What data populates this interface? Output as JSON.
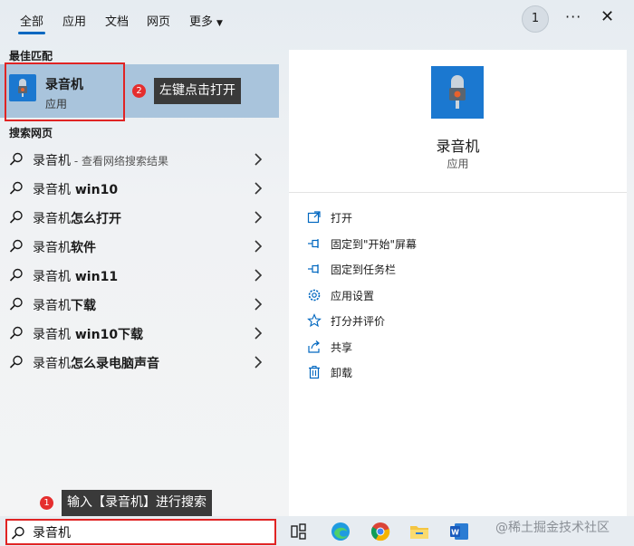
{
  "tabs": {
    "all": "全部",
    "apps": "应用",
    "docs": "文档",
    "web": "网页",
    "more": "更多"
  },
  "header": {
    "count_badge": "1",
    "more_dots": "···",
    "close": "✕"
  },
  "best_match": {
    "section_label": "最佳匹配",
    "name": "录音机",
    "type": "应用",
    "step": "2",
    "tooltip": "左键点击打开"
  },
  "web_search": {
    "section_label": "搜索网页",
    "items": [
      {
        "text": "录音机",
        "suffix": " - 查看网络搜索结果"
      },
      {
        "text": "录音机",
        "bold": " win10"
      },
      {
        "text": "录音机",
        "bold": "怎么打开"
      },
      {
        "text": "录音机",
        "bold": "软件"
      },
      {
        "text": "录音机",
        "bold": " win11"
      },
      {
        "text": "录音机",
        "bold": "下载"
      },
      {
        "text": "录音机",
        "bold": " win10下载"
      },
      {
        "text": "录音机",
        "bold": "怎么录电脑声音"
      }
    ]
  },
  "detail": {
    "name": "录音机",
    "type": "应用",
    "actions": [
      "打开",
      "固定到\"开始\"屏幕",
      "固定到任务栏",
      "应用设置",
      "打分并评价",
      "共享",
      "卸载"
    ]
  },
  "search_tip": {
    "step": "1",
    "text": "输入【录音机】进行搜索"
  },
  "search": {
    "value": "录音机"
  },
  "watermark": "@稀土掘金技术社区",
  "colors": {
    "accent": "#0067c0",
    "app_icon": "#1b78d0",
    "highlight": "#a9c4dc",
    "annotation_red": "#e02424"
  }
}
